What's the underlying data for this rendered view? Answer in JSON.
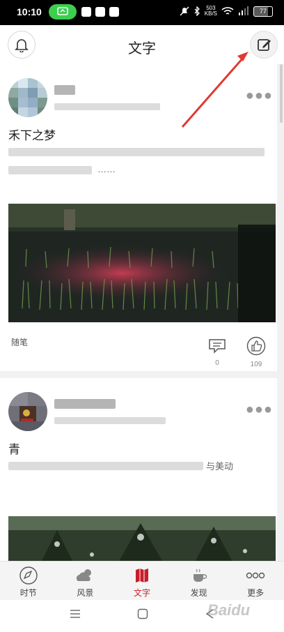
{
  "status_bar": {
    "time": "10:10",
    "network_speed_value": "503",
    "network_speed_unit": "KB/S",
    "battery_percent": "77",
    "battery_level": 0.77
  },
  "header": {
    "title": "文字"
  },
  "posts": [
    {
      "title_visible": "禾下之梦",
      "excerpt_tail": "……",
      "tag": "随笔",
      "comment_count": "0",
      "like_count": "109"
    },
    {
      "title_visible": "青",
      "excerpt_tail": "与美动"
    }
  ],
  "tabs": [
    {
      "label": "时节",
      "icon": "compass-icon"
    },
    {
      "label": "风景",
      "icon": "cloud-sun-icon"
    },
    {
      "label": "文字",
      "icon": "book-map-icon",
      "active": true
    },
    {
      "label": "发现",
      "icon": "coffee-cup-icon"
    },
    {
      "label": "更多",
      "icon": "more-dots-icon"
    }
  ],
  "watermark": "Baidu",
  "colors": {
    "accent": "#c81e2a",
    "status_pill": "#3ccf4e",
    "arrow": "#e03a2f"
  }
}
